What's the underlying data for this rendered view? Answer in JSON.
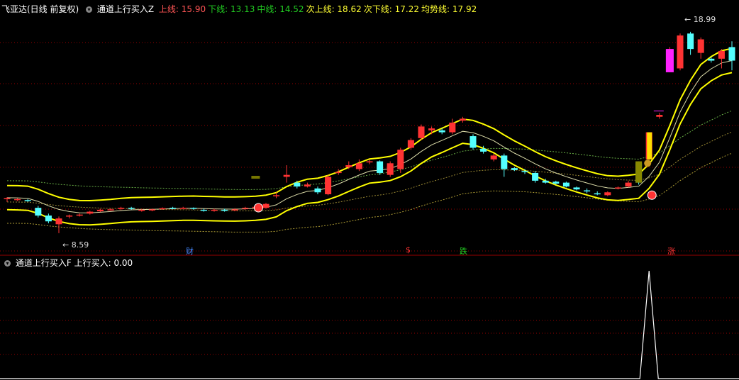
{
  "header": {
    "stock": "飞亚达(日线 前复权)",
    "indicator": "通道上行买入Z",
    "lines": [
      {
        "label": "上线:",
        "value": "15.90",
        "color": "#ff5555"
      },
      {
        "label": "下线:",
        "value": "13.13",
        "color": "#22cc22"
      },
      {
        "label": "中线:",
        "value": "14.52",
        "color": "#22cc22"
      },
      {
        "label": "次上线:",
        "value": "18.62",
        "color": "#ffff33"
      },
      {
        "label": "次下线:",
        "value": "17.22",
        "color": "#ffff33"
      },
      {
        "label": "均势线:",
        "value": "17.92",
        "color": "#ffff33"
      }
    ]
  },
  "sub_header": {
    "indicator": "通道上行买入F",
    "label": "上行买入:",
    "value": "0.00"
  },
  "annotations": {
    "low_label": "8.59",
    "high_label": "18.99",
    "markers": [
      {
        "text": "财",
        "color": "#4488ff"
      },
      {
        "text": "$",
        "color": "#ff3333"
      },
      {
        "text": "跌",
        "color": "#22cc22"
      },
      {
        "text": "涨",
        "color": "#ff3333"
      }
    ]
  },
  "colors": {
    "up": "#ff3333",
    "down": "#54ffff",
    "channel": "#ffff00",
    "divider": "#990000",
    "sub_line": "#ffffff"
  },
  "chart_data": {
    "type": "candlestick",
    "ylim": [
      8.0,
      19.9
    ],
    "candles": [
      [
        10.35,
        10.4,
        10.2,
        10.45
      ],
      [
        10.3,
        10.35,
        10.25,
        10.4
      ],
      [
        10.3,
        10.28,
        10.2,
        10.35
      ],
      [
        9.9,
        9.5,
        9.4,
        10.0
      ],
      [
        9.5,
        9.2,
        9.1,
        9.6
      ],
      [
        9.05,
        9.35,
        8.59,
        9.45
      ],
      [
        9.45,
        9.5,
        9.35,
        9.55
      ],
      [
        9.5,
        9.55,
        9.45,
        9.6
      ],
      [
        9.6,
        9.7,
        9.55,
        9.75
      ],
      [
        9.72,
        9.8,
        9.68,
        9.85
      ],
      [
        9.8,
        9.82,
        9.75,
        9.88
      ],
      [
        9.85,
        9.9,
        9.78,
        9.95
      ],
      [
        9.9,
        9.85,
        9.8,
        9.95
      ],
      [
        9.75,
        9.8,
        9.7,
        9.85
      ],
      [
        9.78,
        9.82,
        9.72,
        9.86
      ],
      [
        9.85,
        9.88,
        9.8,
        9.92
      ],
      [
        9.9,
        9.88,
        9.82,
        9.95
      ],
      [
        9.88,
        9.9,
        9.85,
        9.95
      ],
      [
        9.9,
        9.85,
        9.8,
        9.92
      ],
      [
        9.8,
        9.75,
        9.7,
        9.85
      ],
      [
        9.75,
        9.8,
        9.7,
        9.85
      ],
      [
        9.8,
        9.78,
        9.7,
        9.85
      ],
      [
        9.78,
        9.82,
        9.72,
        9.88
      ],
      [
        9.85,
        9.9,
        9.8,
        9.95
      ],
      [
        9.92,
        9.95,
        9.85,
        10.0
      ],
      [
        9.9,
        10.1,
        9.85,
        10.15
      ],
      [
        10.5,
        10.55,
        10.4,
        10.7
      ],
      [
        11.5,
        11.6,
        11.2,
        12.1
      ],
      [
        11.2,
        11.0,
        10.9,
        11.3
      ],
      [
        11.0,
        11.1,
        10.95,
        11.2
      ],
      [
        10.9,
        10.7,
        10.6,
        11.0
      ],
      [
        10.6,
        11.5,
        10.55,
        11.6
      ],
      [
        11.7,
        11.75,
        11.6,
        11.9
      ],
      [
        12.0,
        12.1,
        11.9,
        12.3
      ],
      [
        11.9,
        12.2,
        11.8,
        12.4
      ],
      [
        12.25,
        12.3,
        12.15,
        12.4
      ],
      [
        12.3,
        11.7,
        11.6,
        12.35
      ],
      [
        11.6,
        12.2,
        11.5,
        12.3
      ],
      [
        11.9,
        12.9,
        11.7,
        13.0
      ],
      [
        13.0,
        13.4,
        12.9,
        13.5
      ],
      [
        13.5,
        14.1,
        13.4,
        14.2
      ],
      [
        13.9,
        14.0,
        13.7,
        14.1
      ],
      [
        13.9,
        13.8,
        13.7,
        14.0
      ],
      [
        13.8,
        14.3,
        13.7,
        14.5
      ],
      [
        14.4,
        14.5,
        14.3,
        14.6
      ],
      [
        13.6,
        13.0,
        12.9,
        13.7
      ],
      [
        12.95,
        12.8,
        12.7,
        13.1
      ],
      [
        12.4,
        12.6,
        12.3,
        12.7
      ],
      [
        12.6,
        11.9,
        11.5,
        12.7
      ],
      [
        11.95,
        11.85,
        11.8,
        12.0
      ],
      [
        11.8,
        11.75,
        11.65,
        11.9
      ],
      [
        11.7,
        11.3,
        11.2,
        11.8
      ],
      [
        11.3,
        11.2,
        11.15,
        11.4
      ],
      [
        11.25,
        11.15,
        11.1,
        11.3
      ],
      [
        11.2,
        11.0,
        10.95,
        11.25
      ],
      [
        10.95,
        10.85,
        10.8,
        11.0
      ],
      [
        10.8,
        10.75,
        10.65,
        10.9
      ],
      [
        10.65,
        10.6,
        10.55,
        10.75
      ],
      [
        10.55,
        10.7,
        10.5,
        10.75
      ],
      [
        10.9,
        10.95,
        10.85,
        11.0
      ],
      [
        11.0,
        11.2,
        10.95,
        11.3
      ],
      [
        12.2,
        11.2,
        11.1,
        12.3
      ],
      [
        12.4,
        13.8,
        12.3,
        13.8
      ],
      [
        14.6,
        14.7,
        14.5,
        14.8
      ],
      [
        17.0,
        18.1,
        16.9,
        18.2
      ],
      [
        17.1,
        18.8,
        17.0,
        18.9
      ],
      [
        18.9,
        18.1,
        17.8,
        18.99
      ],
      [
        17.9,
        18.6,
        17.6,
        18.7
      ],
      [
        17.6,
        17.5,
        17.4,
        17.7
      ],
      [
        17.6,
        18.0,
        17.1,
        18.1
      ],
      [
        18.2,
        17.5,
        17.0,
        18.5
      ]
    ]
  }
}
